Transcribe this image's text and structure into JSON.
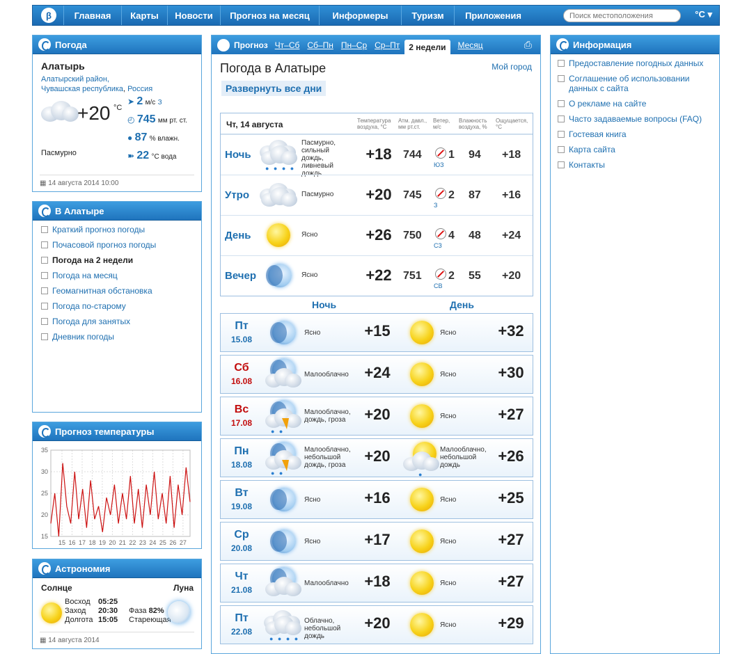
{
  "nav": {
    "logo": "β",
    "items": [
      "Главная",
      "Карты",
      "Новости",
      "Прогноз на месяц",
      "Информеры",
      "Туризм",
      "Приложения"
    ],
    "search_placeholder": "Поиск местоположения",
    "unit": "°C ▾"
  },
  "current": {
    "header": "Погода",
    "city": "Алатырь",
    "region_line1": "Алатырский район,",
    "region_line2a": "Чувашская республика",
    "sep": ",",
    "region_line2b": "Россия",
    "temp": "+20",
    "temp_unit": "°C",
    "condition": "Пасмурно",
    "wind": "2",
    "wind_unit": "м/с",
    "wind_dir": "З",
    "pressure": "745",
    "pressure_unit": "мм рт. ст.",
    "humidity": "87",
    "humidity_unit": "% влажн.",
    "water": "22",
    "water_unit": "°C вода",
    "updated": "14 августа 2014 10:00"
  },
  "in_city": {
    "header": "В Алатыре",
    "links": [
      "Краткий прогноз погоды",
      "Почасовой прогноз погоды",
      "Погода на 2 недели",
      "Погода на месяц",
      "Геомагнитная обстановка",
      "Погода по-старому",
      "Погода для занятых",
      "Дневник погоды"
    ],
    "active_index": 2
  },
  "temp_chart": {
    "header": "Прогноз температуры"
  },
  "chart_data": {
    "type": "line",
    "title": "Прогноз температуры",
    "xlabel": "",
    "ylabel": "",
    "ylim": [
      15,
      35
    ],
    "y_ticks": [
      15,
      20,
      25,
      30,
      35
    ],
    "x_ticks": [
      "15",
      "16",
      "17",
      "18",
      "19",
      "20",
      "21",
      "22",
      "23",
      "24",
      "25",
      "26",
      "27"
    ],
    "series": [
      {
        "values": [
          18,
          25,
          15,
          32,
          22,
          18,
          30,
          19,
          26,
          17,
          28,
          19,
          22,
          16,
          24,
          20,
          27,
          18,
          25,
          19,
          29,
          18,
          26,
          17,
          27,
          20,
          30,
          19,
          25,
          18,
          29,
          17,
          27,
          20,
          31,
          23
        ]
      }
    ],
    "grid": true,
    "color": "#cc1111"
  },
  "astro": {
    "header": "Астрономия",
    "sun_label": "Солнце",
    "moon_label": "Луна",
    "rise_label": "Восход",
    "rise": "05:25",
    "set_label": "Заход",
    "set": "20:30",
    "len_label": "Долгота",
    "len": "15:05",
    "phase_label": "Фаза",
    "phase": "82%",
    "phase_name": "Стареющая",
    "date": "14 августа 2014"
  },
  "forecast": {
    "tab_label": "Прогноз",
    "tabs": [
      "Чт–Сб",
      "Сб–Пн",
      "Пн–Ср",
      "Ср–Пт",
      "2 недели",
      "Месяц"
    ],
    "active_tab": 4,
    "title": "Погода в Алатыре",
    "my_city": "Мой город",
    "expand": "Развернуть все дни",
    "today": "Чт, 14 августа",
    "col_temp": "Температура воздуха, °С",
    "col_press": "Атм. давл., мм рт.ст.",
    "col_wind": "Ветер, м/с",
    "col_hum": "Влажность воздуха, %",
    "col_feel": "Ощущается, °С",
    "night_label": "Ночь",
    "day_label": "День",
    "parts": [
      {
        "label": "Ночь",
        "desc": "Пасмурно, сильный дождь, ливневый дождь",
        "icon": "rain-cloud-icon",
        "temp": "+18",
        "press": "744",
        "wind": "1",
        "dir": "ЮЗ",
        "hum": "94",
        "feel": "+18"
      },
      {
        "label": "Утро",
        "desc": "Пасмурно",
        "icon": "cloud-icon",
        "temp": "+20",
        "press": "745",
        "wind": "2",
        "dir": "З",
        "hum": "87",
        "feel": "+16"
      },
      {
        "label": "День",
        "desc": "Ясно",
        "icon": "sun-icon",
        "temp": "+26",
        "press": "750",
        "wind": "4",
        "dir": "СЗ",
        "hum": "48",
        "feel": "+24"
      },
      {
        "label": "Вечер",
        "desc": "Ясно",
        "icon": "moon-icon",
        "temp": "+22",
        "press": "751",
        "wind": "2",
        "dir": "СВ",
        "hum": "55",
        "feel": "+20"
      }
    ],
    "days": [
      {
        "dn": "Пт",
        "dd": "15.08",
        "weekend": false,
        "n_icon": "moon-icon",
        "n_desc": "Ясно",
        "n_temp": "+15",
        "d_icon": "sun-icon",
        "d_desc": "Ясно",
        "d_temp": "+32"
      },
      {
        "dn": "Сб",
        "dd": "16.08",
        "weekend": true,
        "n_icon": "moon-cloud-icon",
        "n_desc": "Малооблачно",
        "n_temp": "+24",
        "d_icon": "sun-icon",
        "d_desc": "Ясно",
        "d_temp": "+30"
      },
      {
        "dn": "Вс",
        "dd": "17.08",
        "weekend": true,
        "n_icon": "storm-icon",
        "n_desc": "Малооблачно, дождь, гроза",
        "n_temp": "+20",
        "d_icon": "sun-icon",
        "d_desc": "Ясно",
        "d_temp": "+27"
      },
      {
        "dn": "Пн",
        "dd": "18.08",
        "weekend": false,
        "n_icon": "storm-icon",
        "n_desc": "Малооблачно, небольшой дождь, гроза",
        "n_temp": "+20",
        "d_icon": "sun-cloud-rain-icon",
        "d_desc": "Малооблачно, небольшой дождь",
        "d_temp": "+26"
      },
      {
        "dn": "Вт",
        "dd": "19.08",
        "weekend": false,
        "n_icon": "moon-icon",
        "n_desc": "Ясно",
        "n_temp": "+16",
        "d_icon": "sun-icon",
        "d_desc": "Ясно",
        "d_temp": "+25"
      },
      {
        "dn": "Ср",
        "dd": "20.08",
        "weekend": false,
        "n_icon": "moon-icon",
        "n_desc": "Ясно",
        "n_temp": "+17",
        "d_icon": "sun-icon",
        "d_desc": "Ясно",
        "d_temp": "+27"
      },
      {
        "dn": "Чт",
        "dd": "21.08",
        "weekend": false,
        "n_icon": "moon-cloud-icon",
        "n_desc": "Малооблачно",
        "n_temp": "+18",
        "d_icon": "sun-icon",
        "d_desc": "Ясно",
        "d_temp": "+27"
      },
      {
        "dn": "Пт",
        "dd": "22.08",
        "weekend": false,
        "n_icon": "rain-cloud-icon",
        "n_desc": "Облачно, небольшой дождь",
        "n_temp": "+20",
        "d_icon": "sun-icon",
        "d_desc": "Ясно",
        "d_temp": "+29"
      }
    ]
  },
  "info": {
    "header": "Информация",
    "links": [
      "Предоставление погодных данных",
      "Соглашение об использовании данных с сайта",
      "О рекламе на сайте",
      "Часто задаваемые вопросы (FAQ)",
      "Гостевая книга",
      "Карта сайта",
      "Контакты"
    ]
  }
}
